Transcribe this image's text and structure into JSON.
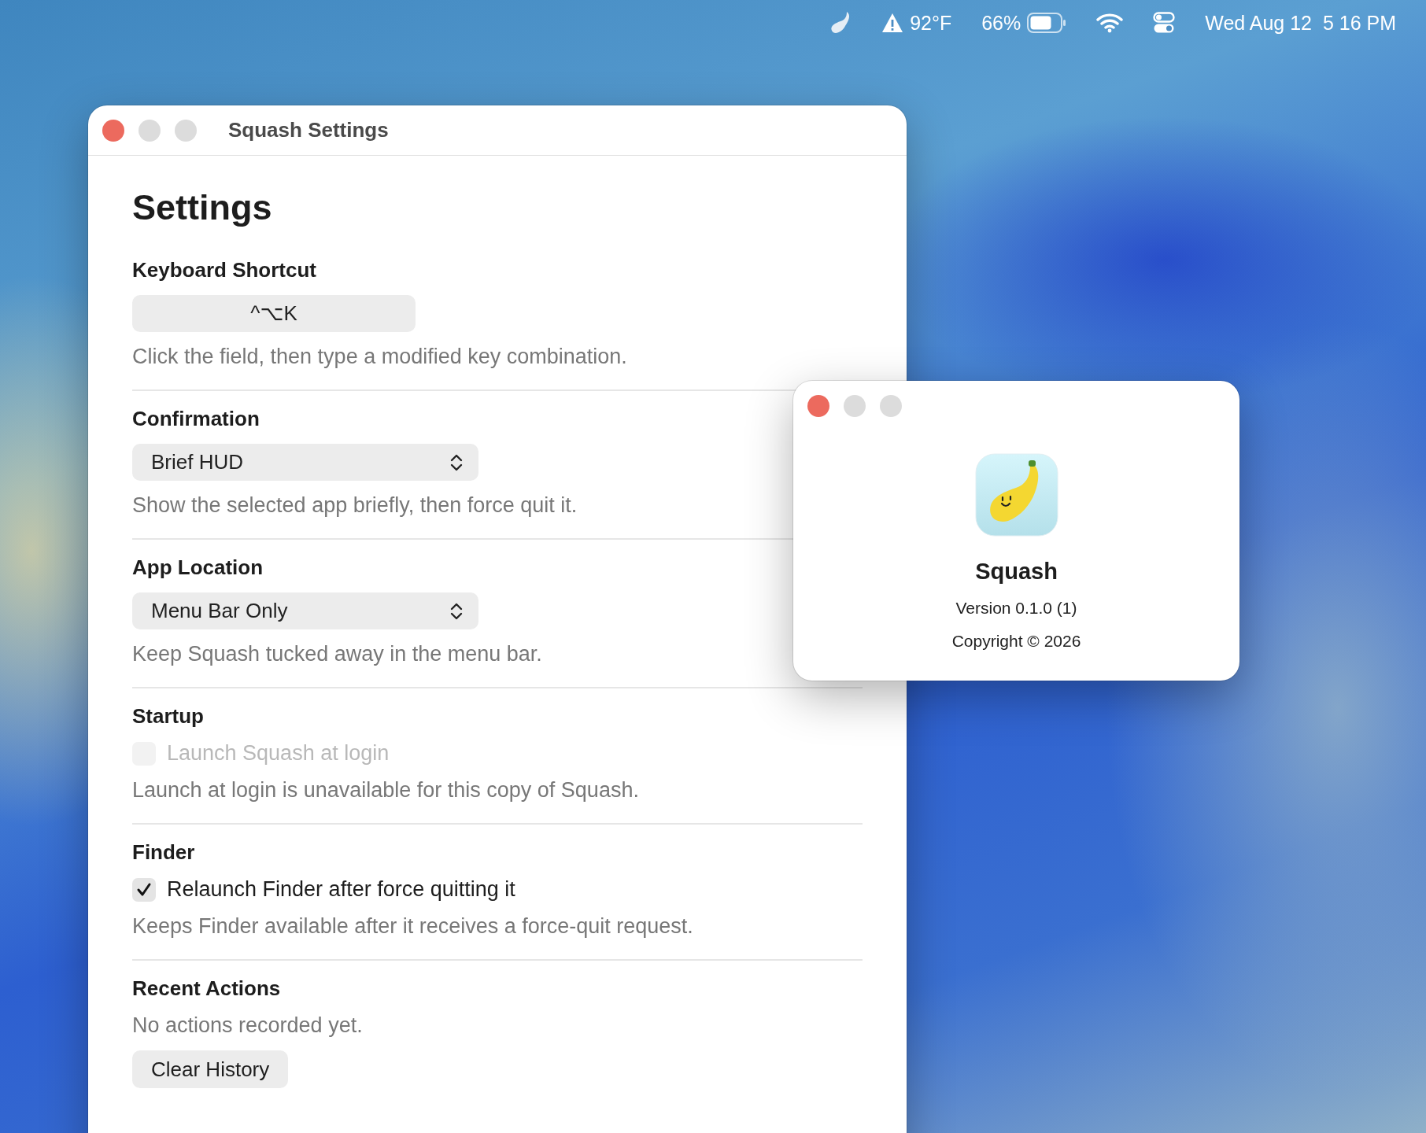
{
  "menu_bar": {
    "weather": "92°F",
    "battery": "66%",
    "clock": "Wed Aug 12  5 16 PM"
  },
  "settings_window": {
    "title": "Squash Settings",
    "heading": "Settings",
    "sections": [
      {
        "kind": "shortcut",
        "title": "Keyboard Shortcut",
        "value": "^⌥K",
        "help": "Click the field, then type a modified key combination."
      },
      {
        "kind": "popup",
        "title": "Confirmation",
        "value": "Brief HUD",
        "help": "Show the selected app briefly, then force quit it."
      },
      {
        "kind": "popup",
        "title": "App Location",
        "value": "Menu Bar Only",
        "help": "Keep Squash tucked away in the menu bar."
      },
      {
        "kind": "checkbox",
        "title": "Startup",
        "label": "Launch Squash at login",
        "checked": false,
        "disabled": true,
        "help": "Launch at login is unavailable for this copy of Squash."
      },
      {
        "kind": "checkbox",
        "title": "Finder",
        "label": "Relaunch Finder after force quitting it",
        "checked": true,
        "disabled": false,
        "help": "Keeps Finder available after it receives a force-quit request."
      },
      {
        "kind": "history",
        "title": "Recent Actions",
        "empty_text": "No actions recorded yet.",
        "button": "Clear History"
      }
    ]
  },
  "about_window": {
    "app_name": "Squash",
    "version": "Version 0.1.0 (1)",
    "copyright": "Copyright © 2026"
  }
}
